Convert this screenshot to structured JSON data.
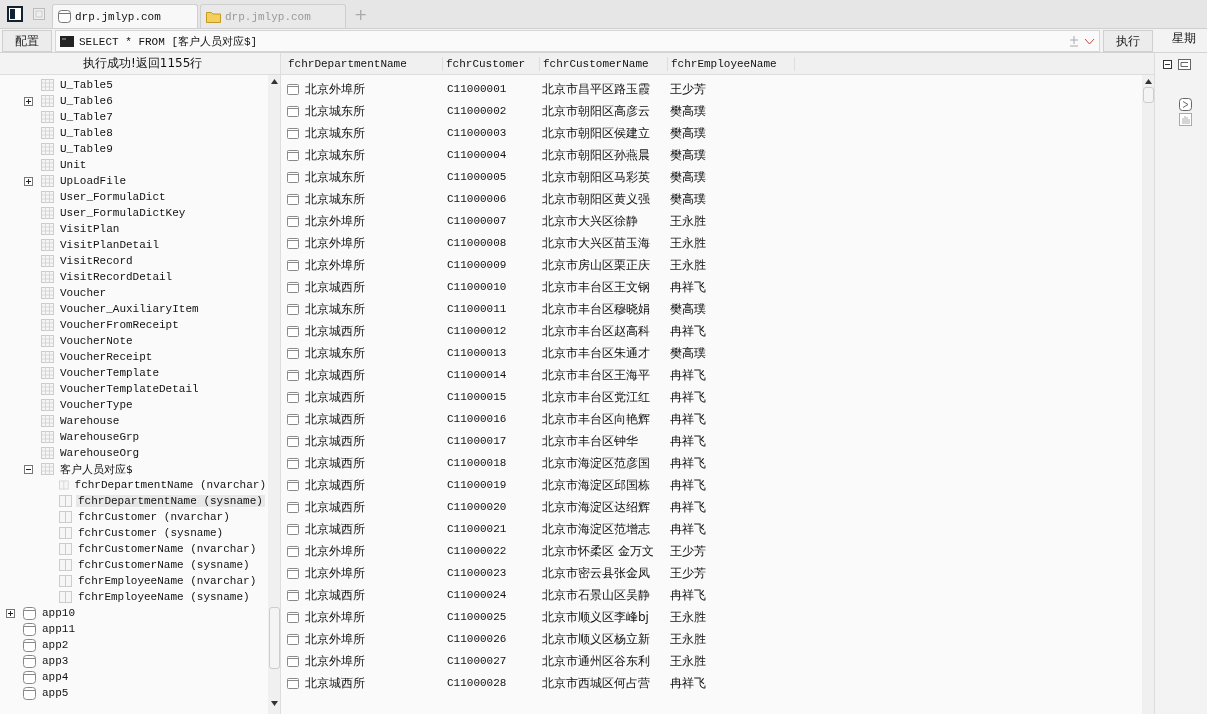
{
  "tabs": [
    {
      "label": "drp.jmlyp.com",
      "selected": true
    },
    {
      "label": "drp.jmlyp.com",
      "selected": false
    }
  ],
  "new_tab": "+",
  "toolbar": {
    "config_button": "配置",
    "query": "SELECT * FROM [客户人员对应$]",
    "run_button": "执行",
    "side_header": "星期"
  },
  "status": "执行成功!返回1155行",
  "tree": {
    "continued_children": [
      {
        "label": "U_Table5",
        "kind": "table"
      },
      {
        "label": "U_Table6",
        "kind": "table",
        "expanded": false
      },
      {
        "label": "U_Table7",
        "kind": "table"
      },
      {
        "label": "U_Table8",
        "kind": "table"
      },
      {
        "label": "U_Table9",
        "kind": "table"
      },
      {
        "label": "Unit",
        "kind": "table"
      },
      {
        "label": "UpLoadFile",
        "kind": "table",
        "expanded": false
      },
      {
        "label": "User_FormulaDict",
        "kind": "table"
      },
      {
        "label": "User_FormulaDictKey",
        "kind": "table"
      },
      {
        "label": "VisitPlan",
        "kind": "table"
      },
      {
        "label": "VisitPlanDetail",
        "kind": "table"
      },
      {
        "label": "VisitRecord",
        "kind": "table"
      },
      {
        "label": "VisitRecordDetail",
        "kind": "table"
      },
      {
        "label": "Voucher",
        "kind": "table"
      },
      {
        "label": "Voucher_AuxiliaryItem",
        "kind": "table"
      },
      {
        "label": "VoucherFromReceipt",
        "kind": "table"
      },
      {
        "label": "VoucherNote",
        "kind": "table"
      },
      {
        "label": "VoucherReceipt",
        "kind": "table"
      },
      {
        "label": "VoucherTemplate",
        "kind": "table"
      },
      {
        "label": "VoucherTemplateDetail",
        "kind": "table"
      },
      {
        "label": "VoucherType",
        "kind": "table"
      },
      {
        "label": "Warehouse",
        "kind": "table"
      },
      {
        "label": "WarehouseGrp",
        "kind": "table"
      },
      {
        "label": "WarehouseOrg",
        "kind": "table"
      },
      {
        "label": "客户人员对应$",
        "kind": "table",
        "expanded": true,
        "children": [
          {
            "label": "fchrDepartmentName (nvarchar)",
            "kind": "column",
            "selected": false
          },
          {
            "label": "fchrDepartmentName (sysname)",
            "kind": "column",
            "selected": true
          },
          {
            "label": "fchrCustomer (nvarchar)",
            "kind": "column",
            "selected": false
          },
          {
            "label": "fchrCustomer (sysname)",
            "kind": "column",
            "selected": false
          },
          {
            "label": "fchrCustomerName (nvarchar)",
            "kind": "column",
            "selected": false
          },
          {
            "label": "fchrCustomerName (sysname)",
            "kind": "column",
            "selected": false
          },
          {
            "label": "fchrEmployeeName (nvarchar)",
            "kind": "column",
            "selected": false
          },
          {
            "label": "fchrEmployeeName (sysname)",
            "kind": "column",
            "selected": false
          }
        ]
      }
    ],
    "items": [
      {
        "label": "app10",
        "kind": "database",
        "expanded": false
      },
      {
        "label": "app11",
        "kind": "database"
      },
      {
        "label": "app2",
        "kind": "database"
      },
      {
        "label": "app3",
        "kind": "database"
      },
      {
        "label": "app4",
        "kind": "database"
      },
      {
        "label": "app5",
        "kind": "database"
      }
    ]
  },
  "table": {
    "columns": [
      "fchrDepartmentName",
      "fchrCustomer",
      "fchrCustomerName",
      "fchrEmployeeName"
    ],
    "rows": [
      [
        "北京外埠所",
        "C11000001",
        "北京市昌平区路玉霞",
        "王少芳"
      ],
      [
        "北京城东所",
        "C11000002",
        "北京市朝阳区高彦云",
        "樊高璞"
      ],
      [
        "北京城东所",
        "C11000003",
        "北京市朝阳区侯建立",
        "樊高璞"
      ],
      [
        "北京城东所",
        "C11000004",
        "北京市朝阳区孙燕晨",
        "樊高璞"
      ],
      [
        "北京城东所",
        "C11000005",
        "北京市朝阳区马彩英",
        "樊高璞"
      ],
      [
        "北京城东所",
        "C11000006",
        "北京市朝阳区黄义强",
        "樊高璞"
      ],
      [
        "北京外埠所",
        "C11000007",
        "北京市大兴区徐静",
        "王永胜"
      ],
      [
        "北京外埠所",
        "C11000008",
        "北京市大兴区苗玉海",
        "王永胜"
      ],
      [
        "北京外埠所",
        "C11000009",
        "北京市房山区栗正庆",
        "王永胜"
      ],
      [
        "北京城西所",
        "C11000010",
        "北京市丰台区王文钢",
        "冉祥飞"
      ],
      [
        "北京城东所",
        "C11000011",
        "北京市丰台区穆晓娟",
        "樊高璞"
      ],
      [
        "北京城西所",
        "C11000012",
        "北京市丰台区赵高科",
        "冉祥飞"
      ],
      [
        "北京城东所",
        "C11000013",
        "北京市丰台区朱通才",
        "樊高璞"
      ],
      [
        "北京城西所",
        "C11000014",
        "北京市丰台区王海平",
        "冉祥飞"
      ],
      [
        "北京城西所",
        "C11000015",
        "北京市丰台区党江红",
        "冉祥飞"
      ],
      [
        "北京城西所",
        "C11000016",
        "北京市丰台区向艳辉",
        "冉祥飞"
      ],
      [
        "北京城西所",
        "C11000017",
        "北京市丰台区钟华",
        "冉祥飞"
      ],
      [
        "北京城西所",
        "C11000018",
        "北京市海淀区范彦国",
        "冉祥飞"
      ],
      [
        "北京城西所",
        "C11000019",
        "北京市海淀区邱国栋",
        "冉祥飞"
      ],
      [
        "北京城西所",
        "C11000020",
        "北京市海淀区达绍辉",
        "冉祥飞"
      ],
      [
        "北京城西所",
        "C11000021",
        "北京市海淀区范增志",
        "冉祥飞"
      ],
      [
        "北京外埠所",
        "C11000022",
        "北京市怀柔区 金万文",
        "王少芳"
      ],
      [
        "北京外埠所",
        "C11000023",
        "北京市密云县张金凤",
        "王少芳"
      ],
      [
        "北京城西所",
        "C11000024",
        "北京市石景山区吴静",
        "冉祥飞"
      ],
      [
        "北京外埠所",
        "C11000025",
        "北京市顺义区李峰bj",
        "王永胜"
      ],
      [
        "北京外埠所",
        "C11000026",
        "北京市顺义区杨立新",
        "王永胜"
      ],
      [
        "北京外埠所",
        "C11000027",
        "北京市通州区谷东利",
        "王永胜"
      ],
      [
        "北京城西所",
        "C11000028",
        "北京市西城区何占营",
        "冉祥飞"
      ]
    ]
  }
}
